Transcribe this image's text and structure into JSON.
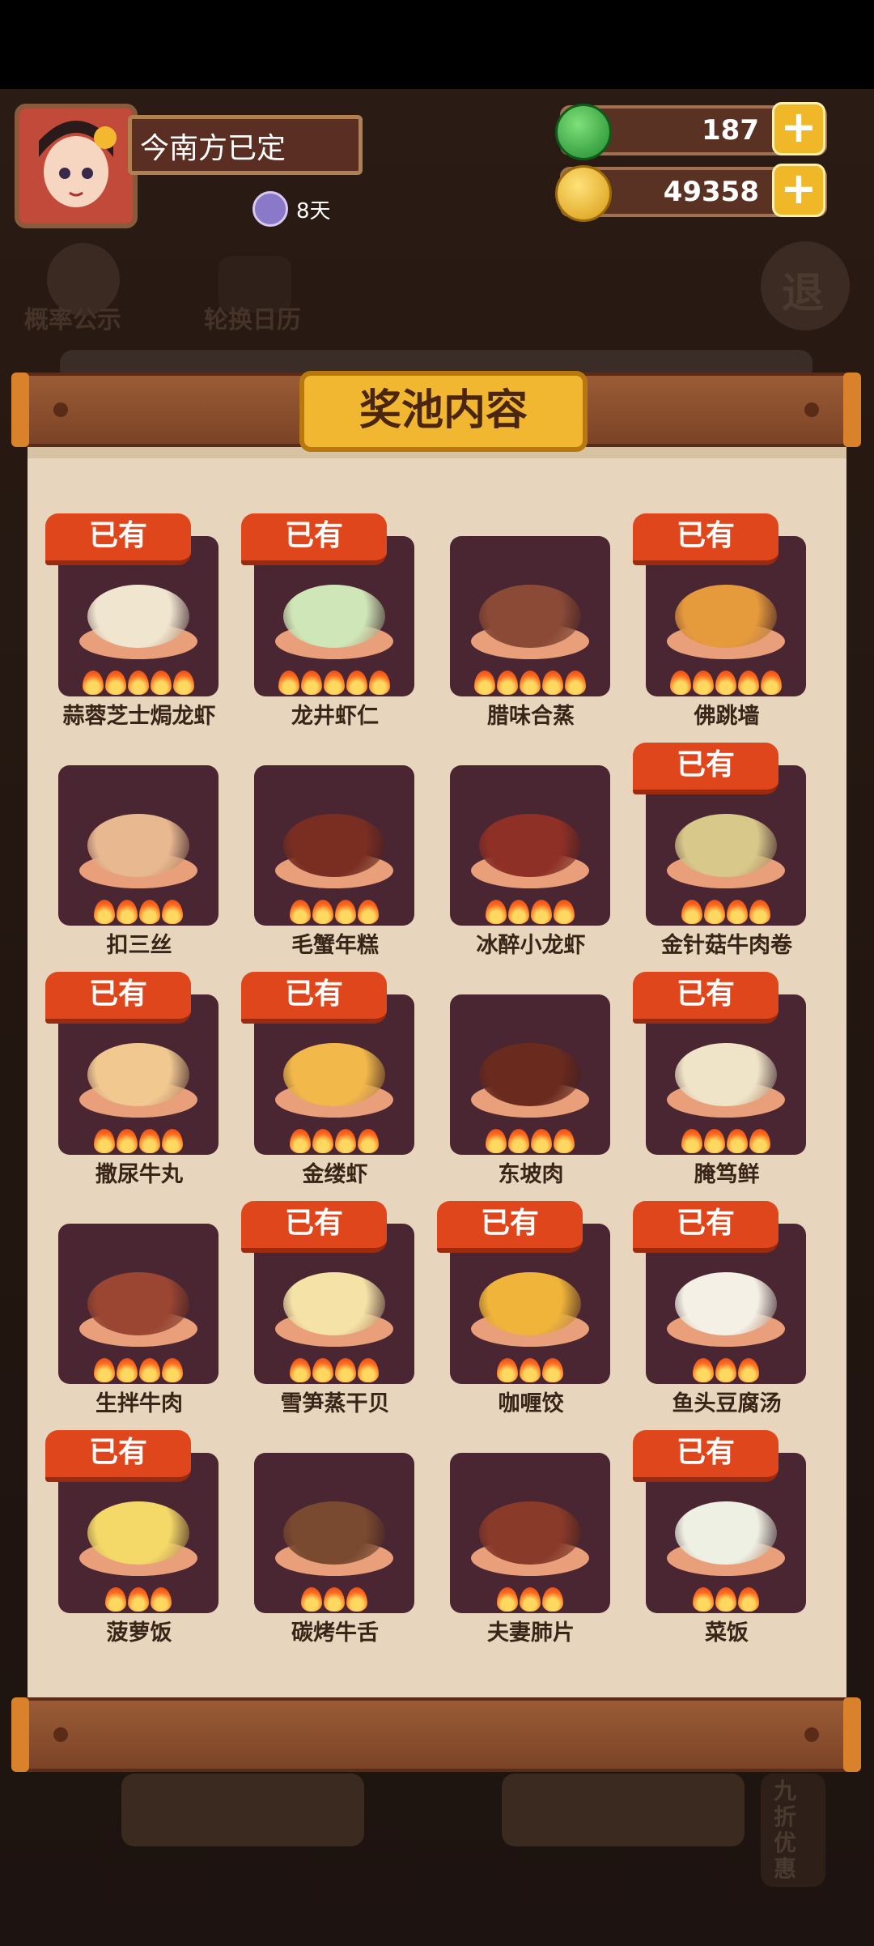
{
  "header": {
    "username": "今南方已定",
    "days_label": "8天",
    "currencies": [
      {
        "name": "jade",
        "value": "187",
        "icon": "jade-coin-icon",
        "color": "#2fa83a"
      },
      {
        "name": "gold",
        "value": "49358",
        "icon": "gold-coin-icon",
        "color": "#e7b21f"
      }
    ]
  },
  "background_menu": {
    "probability": "概率公示",
    "calendar": "轮换日历",
    "exit": "退",
    "discount": "九折优惠"
  },
  "panel": {
    "title": "奖池内容",
    "owned_badge": "已有"
  },
  "items": [
    {
      "name": "蒜蓉芝士焗龙虾",
      "owned": true,
      "flames": 5,
      "color": "#f0e6d0"
    },
    {
      "name": "龙井虾仁",
      "owned": true,
      "flames": 5,
      "color": "#cfe6b8"
    },
    {
      "name": "腊味合蒸",
      "owned": false,
      "flames": 5,
      "color": "#8a4a36"
    },
    {
      "name": "佛跳墙",
      "owned": true,
      "flames": 5,
      "color": "#e59a3c"
    },
    {
      "name": "扣三丝",
      "owned": false,
      "flames": 4,
      "color": "#e8b890"
    },
    {
      "name": "毛蟹年糕",
      "owned": false,
      "flames": 4,
      "color": "#7a2e22"
    },
    {
      "name": "冰醉小龙虾",
      "owned": false,
      "flames": 4,
      "color": "#8e3026"
    },
    {
      "name": "金针菇牛肉卷",
      "owned": true,
      "flames": 4,
      "color": "#d8c88a"
    },
    {
      "name": "撒尿牛丸",
      "owned": true,
      "flames": 4,
      "color": "#f0c890"
    },
    {
      "name": "金缕虾",
      "owned": true,
      "flames": 4,
      "color": "#f2b84a"
    },
    {
      "name": "东坡肉",
      "owned": false,
      "flames": 4,
      "color": "#6a2a1e"
    },
    {
      "name": "腌笃鲜",
      "owned": true,
      "flames": 4,
      "color": "#efe4c8"
    },
    {
      "name": "生拌牛肉",
      "owned": false,
      "flames": 4,
      "color": "#9a4632"
    },
    {
      "name": "雪笋蒸干贝",
      "owned": true,
      "flames": 4,
      "color": "#f5e2a6"
    },
    {
      "name": "咖喱饺",
      "owned": true,
      "flames": 3,
      "color": "#f0b43a"
    },
    {
      "name": "鱼头豆腐汤",
      "owned": true,
      "flames": 3,
      "color": "#f4f0e6"
    },
    {
      "name": "菠萝饭",
      "owned": true,
      "flames": 3,
      "color": "#f4d868"
    },
    {
      "name": "碳烤牛舌",
      "owned": false,
      "flames": 3,
      "color": "#7a4a30"
    },
    {
      "name": "夫妻肺片",
      "owned": false,
      "flames": 3,
      "color": "#8a3a28"
    },
    {
      "name": "菜饭",
      "owned": true,
      "flames": 3,
      "color": "#eef0e4"
    }
  ]
}
